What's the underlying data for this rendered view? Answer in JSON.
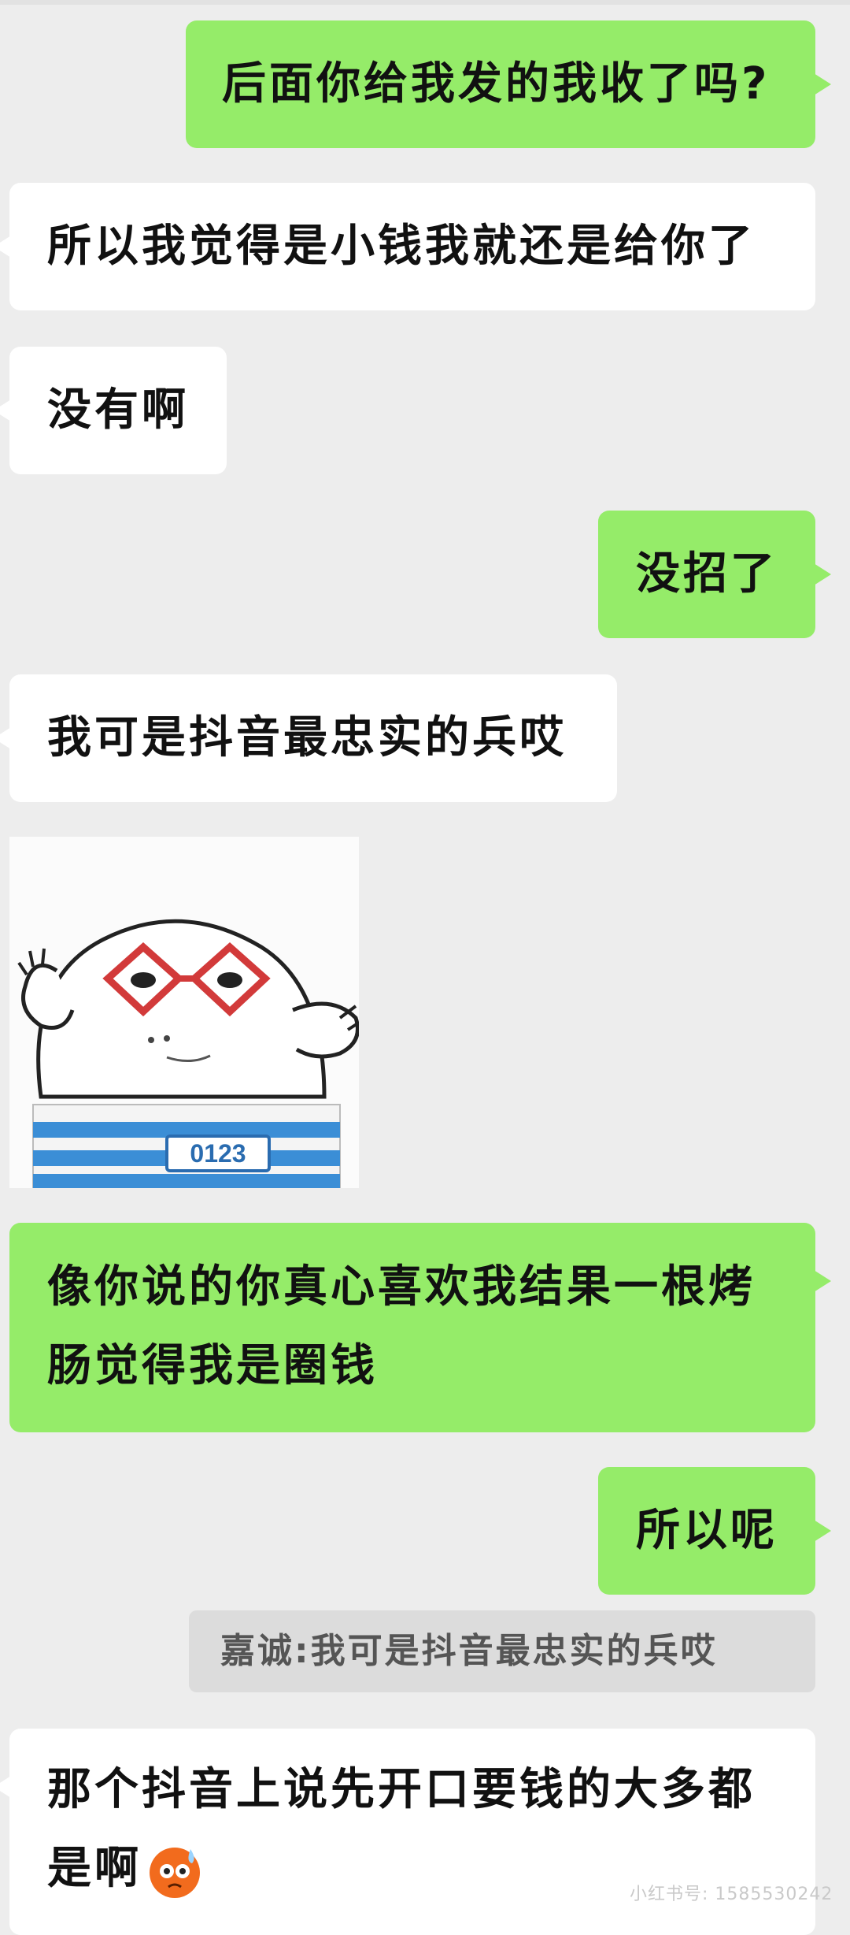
{
  "messages": [
    {
      "side": "right",
      "text": "后面你给我发的我收了吗?"
    },
    {
      "side": "left",
      "text": "所以我觉得是小钱我就还是给你了"
    },
    {
      "side": "left",
      "text": "没有啊"
    },
    {
      "side": "right",
      "text": "没招了"
    },
    {
      "side": "left",
      "text": "我可是抖音最忠实的兵哎"
    },
    {
      "side": "right",
      "line1": "像你说的你真心喜欢我结果一根烤",
      "line2": "肠觉得我是圈钱"
    },
    {
      "side": "right",
      "text": "所以呢"
    },
    {
      "side": "left",
      "line1": "那个抖音上说先开口要钱的大多都",
      "line2": "是啊"
    }
  ],
  "quote": {
    "text": "嘉诚:我可是抖音最忠实的兵哎"
  },
  "sticker": {
    "label": "0123"
  },
  "watermark": "小红书号: 1585530242",
  "colors": {
    "sent": "#95ec69",
    "received": "#ffffff",
    "background": "#ededed"
  }
}
